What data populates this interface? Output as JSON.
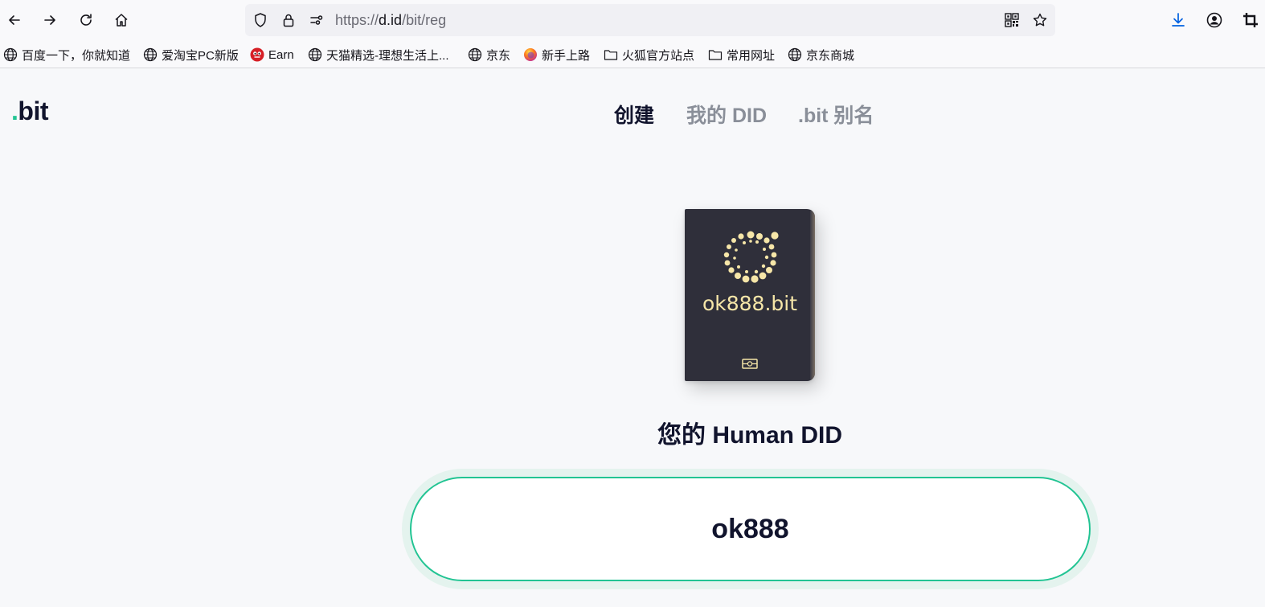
{
  "browser": {
    "url_prefix": "https://",
    "url_host": "d.id",
    "url_path": "/bit/reg",
    "bookmarks": [
      {
        "label": "百度一下，你就知道",
        "icon": "globe-icon"
      },
      {
        "label": "爱淘宝PC新版",
        "icon": "globe-icon"
      },
      {
        "label": "Earn",
        "icon": "earn-favicon"
      },
      {
        "label": "天猫精选-理想生活上...",
        "icon": "globe-icon"
      },
      {
        "label": "京东",
        "icon": "globe-icon"
      },
      {
        "label": "新手上路",
        "icon": "firefox-icon"
      },
      {
        "label": "火狐官方站点",
        "icon": "folder-icon"
      },
      {
        "label": "常用网址",
        "icon": "folder-icon"
      },
      {
        "label": "京东商城",
        "icon": "globe-icon"
      }
    ]
  },
  "site": {
    "logo_dot": ".",
    "logo_text": "bit",
    "nav": [
      {
        "label": "创建",
        "active": true
      },
      {
        "label": "我的 DID",
        "active": false
      },
      {
        "label": ".bit 别名",
        "active": false
      }
    ]
  },
  "main": {
    "passport_name": "ok888.bit",
    "subtitle": "您的 Human DID",
    "account_name": "ok888"
  },
  "colors": {
    "accent": "#22c493",
    "text_dark": "#11142d",
    "text_muted": "#8a8f99",
    "passport_gold": "#f6e6a8",
    "passport_cover": "#2f2f3a"
  }
}
